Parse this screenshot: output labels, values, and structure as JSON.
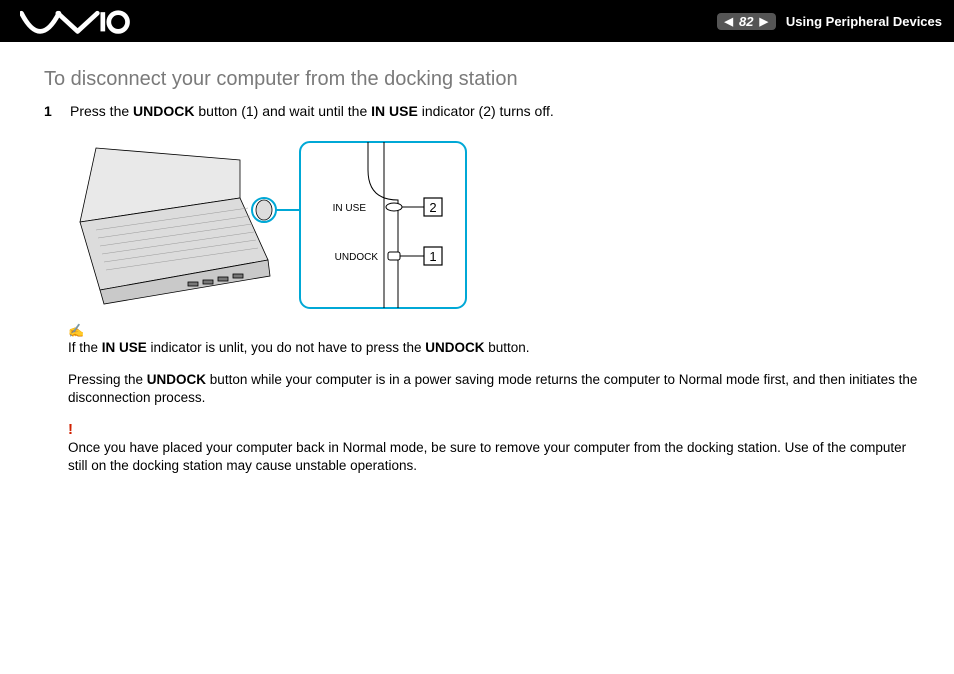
{
  "header": {
    "page_number": "82",
    "section": "Using Peripheral Devices",
    "prev_glyph": "◀",
    "next_glyph": "▶"
  },
  "title": "To disconnect your computer from the docking station",
  "step1": {
    "num": "1",
    "t1": "Press the ",
    "b1": "UNDOCK",
    "t2": " button (1) and wait until the ",
    "b2": "IN USE",
    "t3": " indicator (2) turns off."
  },
  "figure": {
    "label_inuse": "IN USE",
    "label_undock": "UNDOCK",
    "callout1": "1",
    "callout2": "2"
  },
  "note_icon": "✍",
  "note1": {
    "t1": "If the ",
    "b1": "IN USE",
    "t2": " indicator is unlit, you do not have to press the ",
    "b2": "UNDOCK",
    "t3": " button."
  },
  "note2": {
    "t1": "Pressing the ",
    "b1": "UNDOCK",
    "t2": " button while your computer is in a power saving mode returns the computer to Normal mode first, and then initiates the disconnection process."
  },
  "warn_icon": "!",
  "warn": "Once you have placed your computer back in Normal mode, be sure to remove your computer from the docking station. Use of the computer still on the docking station may cause unstable operations."
}
